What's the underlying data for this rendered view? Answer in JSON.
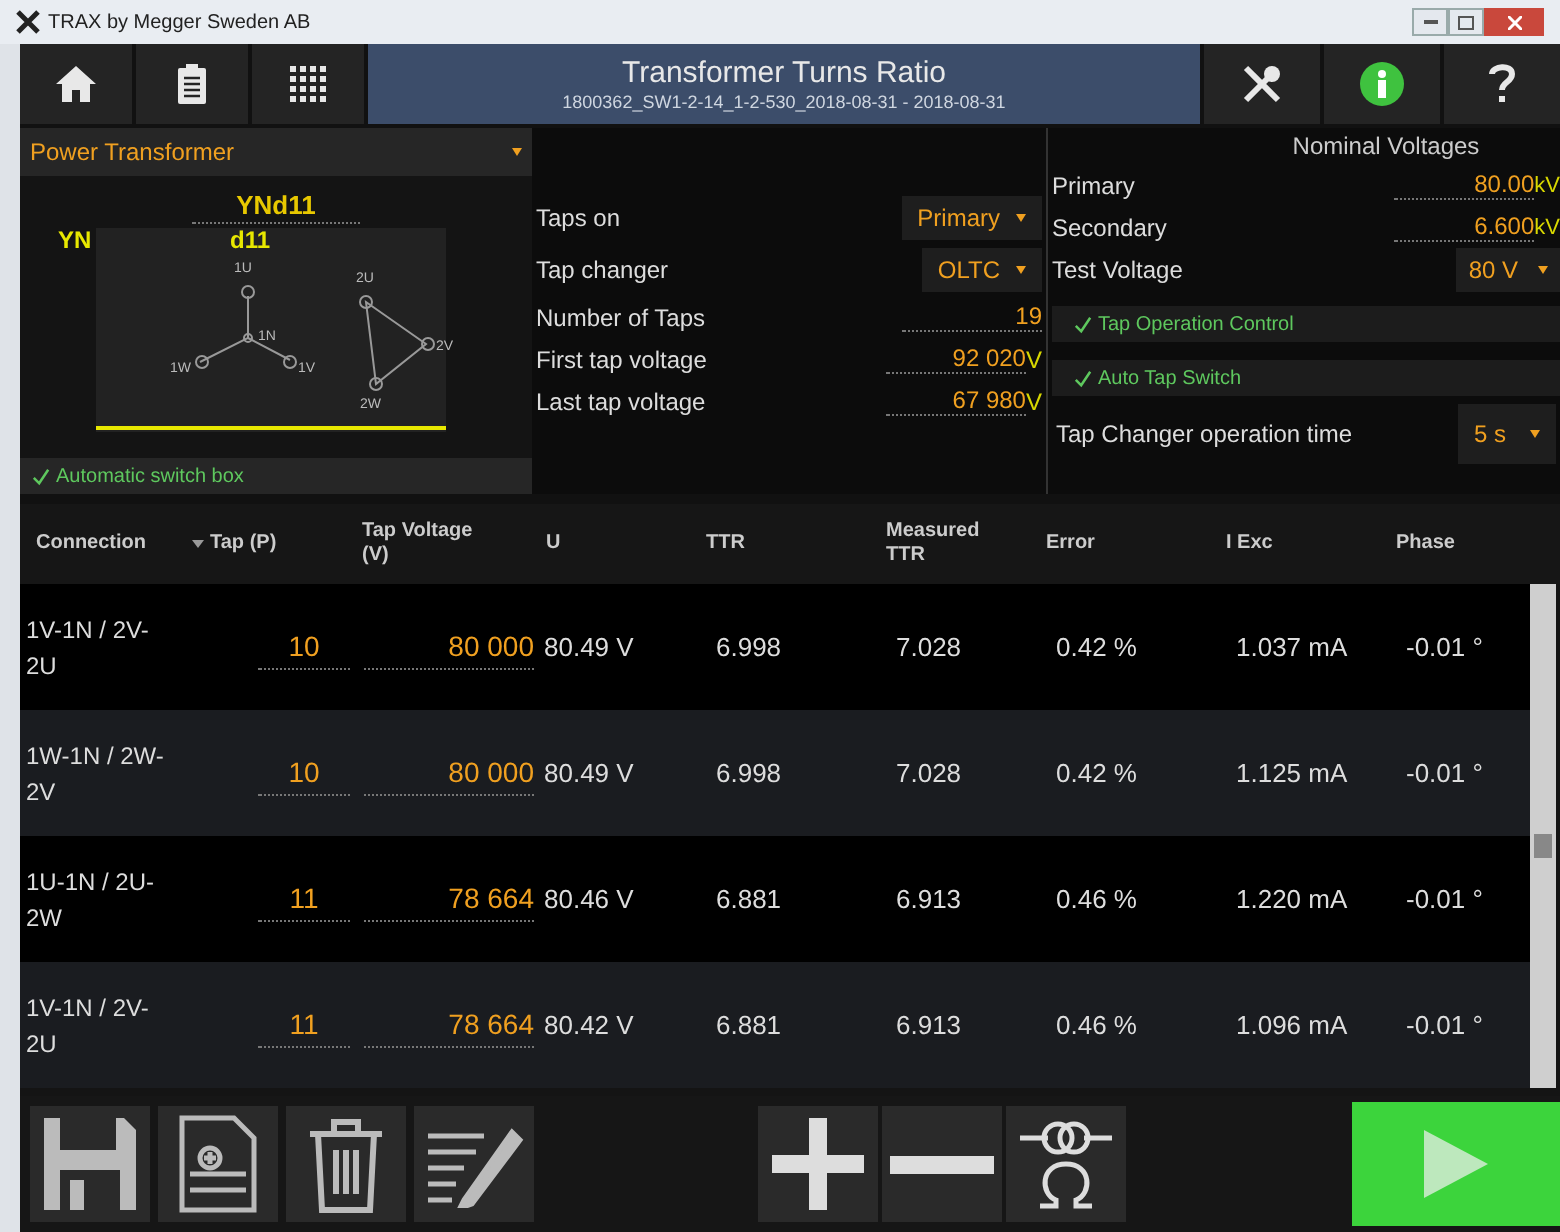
{
  "window": {
    "title": "TRAX by Megger Sweden AB"
  },
  "header": {
    "title": "Transformer Turns Ratio",
    "subtitle": "1800362_SW1-2-14_1-2-530_2018-08-31 - 2018-08-31"
  },
  "transformer": {
    "type": "Power Transformer",
    "vector_group": "YNd11",
    "primary": "YN",
    "secondary": "d11",
    "primary_nodes": [
      "1U",
      "1N",
      "1W",
      "1V"
    ],
    "secondary_nodes": [
      "2U",
      "2V",
      "2W"
    ],
    "automatic_switch_box": {
      "label": "Automatic switch box",
      "checked": true
    }
  },
  "taps": [
    {
      "kind": "dropdown",
      "label": "Taps on",
      "value": "Primary"
    },
    {
      "kind": "dropdown",
      "label": "Tap changer",
      "value": "OLTC"
    },
    {
      "kind": "input",
      "label": "Number of Taps",
      "value": "19"
    },
    {
      "kind": "input",
      "label": "First tap voltage",
      "value": "92 020",
      "unit": "V"
    },
    {
      "kind": "input",
      "label": "Last tap voltage",
      "value": "67 980",
      "unit": "V"
    }
  ],
  "nominal_voltages": {
    "title": "Nominal Voltages",
    "fields": [
      {
        "kind": "input",
        "label": "Primary",
        "value": "80.00",
        "unit": "kV"
      },
      {
        "kind": "input",
        "label": "Secondary",
        "value": "6.600",
        "unit": "kV"
      },
      {
        "kind": "dropdown",
        "label": "Test Voltage",
        "value": "80 V"
      }
    ]
  },
  "options": [
    {
      "label": "Tap Operation Control",
      "checked": true
    },
    {
      "label": "Auto Tap Switch",
      "checked": true
    }
  ],
  "tap_changer_time": {
    "label": "Tap Changer operation time",
    "value": "5 s"
  },
  "table": {
    "columns": [
      {
        "label": "Connection",
        "sorted": false
      },
      {
        "label": "Tap (P)",
        "sorted": true
      },
      {
        "label": "Tap Voltage (V)",
        "sorted": false
      },
      {
        "label": "U",
        "sorted": false
      },
      {
        "label": "TTR",
        "sorted": false
      },
      {
        "label": "Measured TTR",
        "sorted": false
      },
      {
        "label": "Error",
        "sorted": false
      },
      {
        "label": "I Exc",
        "sorted": false
      },
      {
        "label": "Phase",
        "sorted": false
      }
    ],
    "rows": [
      [
        "1V-1N / 2V-2U",
        "10",
        "80 000",
        "80.49 V",
        "6.998",
        "7.028",
        "0.42 %",
        "1.037 mA",
        "-0.01 °"
      ],
      [
        "1W-1N / 2W-2V",
        "10",
        "80 000",
        "80.49 V",
        "6.998",
        "7.028",
        "0.42 %",
        "1.125 mA",
        "-0.01 °"
      ],
      [
        "1U-1N / 2U-2W",
        "11",
        "78 664",
        "80.46 V",
        "6.881",
        "6.913",
        "0.46 %",
        "1.220 mA",
        "-0.01 °"
      ],
      [
        "1V-1N / 2V-2U",
        "11",
        "78 664",
        "80.42 V",
        "6.881",
        "6.913",
        "0.46 %",
        "1.096 mA",
        "-0.01 °"
      ]
    ]
  }
}
